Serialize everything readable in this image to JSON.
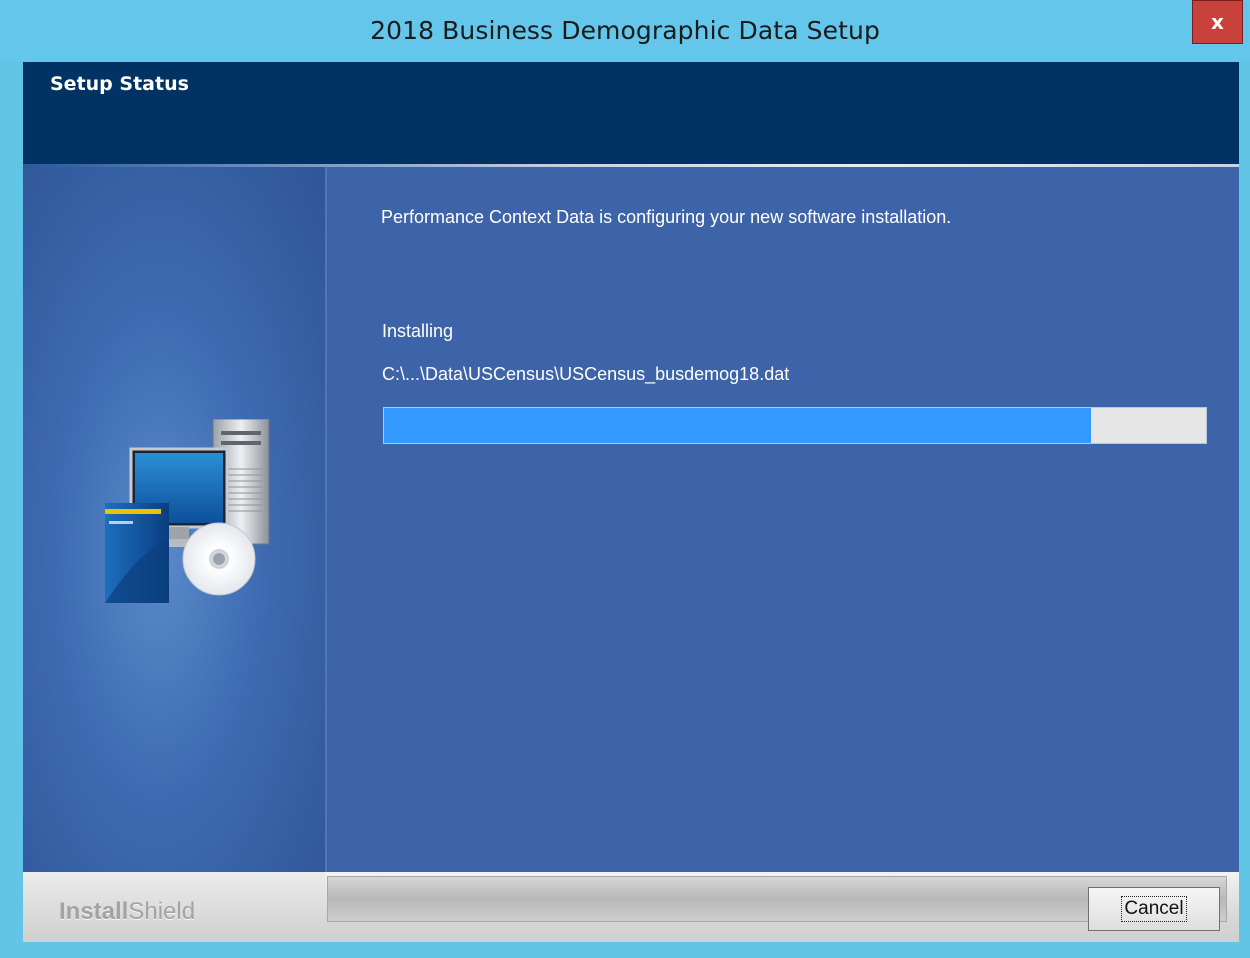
{
  "window": {
    "title": "2018 Business Demographic Data Setup",
    "close_glyph": "x"
  },
  "header": {
    "title": "Setup Status"
  },
  "main": {
    "message": "Performance Context Data is configuring your new software installation.",
    "status_label": "Installing",
    "current_file": "C:\\...\\Data\\USCensus\\USCensus_busdemog18.dat",
    "progress_fraction": 0.86
  },
  "footer": {
    "brand_bold": "Install",
    "brand_thin": "Shield",
    "cancel_label": "Cancel"
  },
  "colors": {
    "titlebar": "#63c6ea",
    "header": "#003263",
    "panel": "#3d64a9",
    "progress_fill": "#3399ff",
    "close_button": "#c8413a"
  },
  "icons": {
    "sidebar_graphic": "computer-box-cd-icon",
    "close": "close-icon"
  }
}
